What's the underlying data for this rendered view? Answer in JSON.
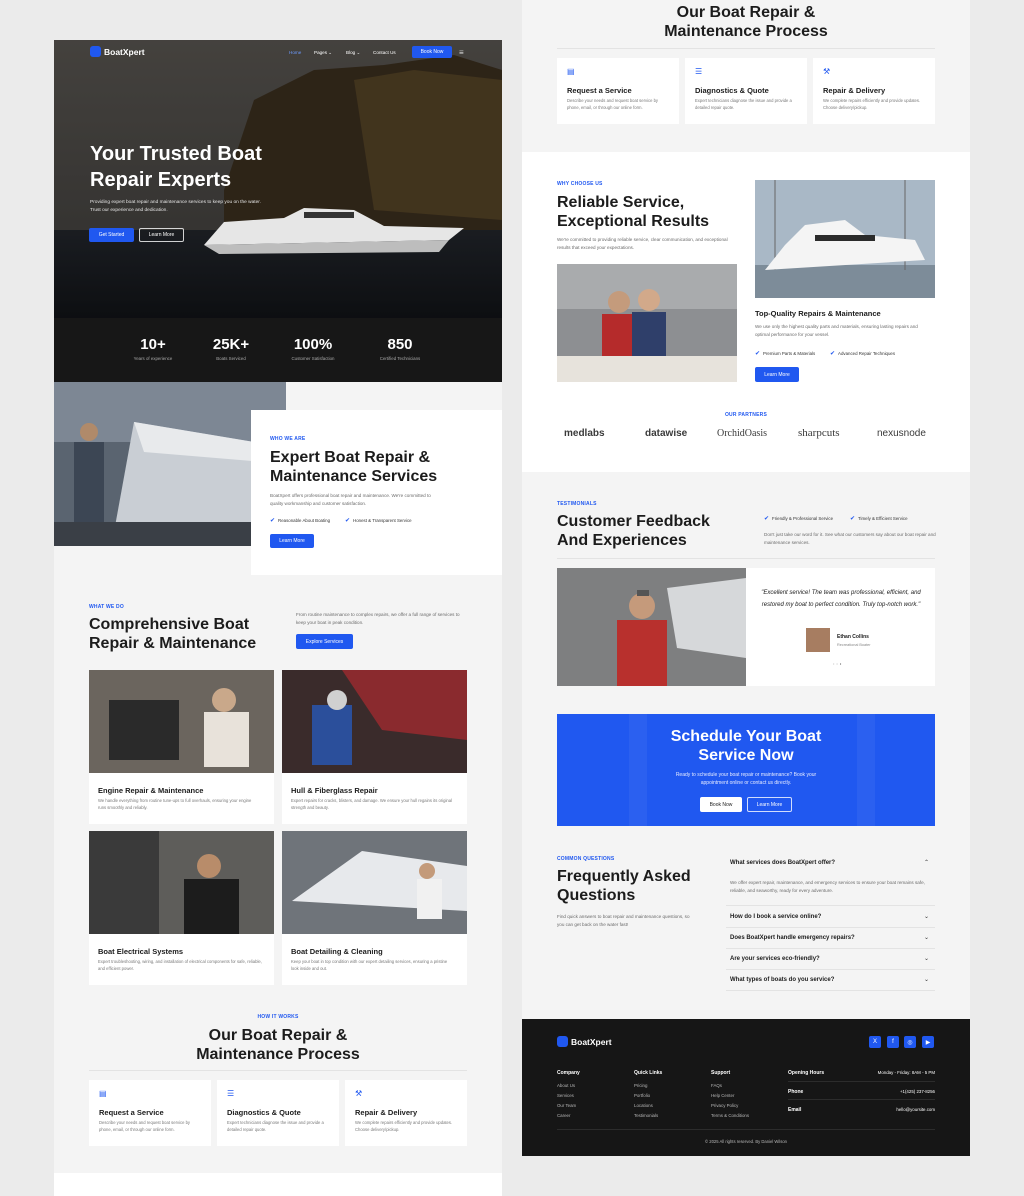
{
  "brand": {
    "name": "BoatXpert"
  },
  "nav": {
    "items": [
      "Home",
      "Pages ⌄",
      "Blog ⌄",
      "Contact Us"
    ],
    "cta": "Book Now"
  },
  "hero": {
    "title_line1": "Your Trusted Boat",
    "title_line2": "Repair Experts",
    "subtitle": "Providing expert boat repair and maintenance services to keep you on the water. Trust our experience and dedication.",
    "primary_btn": "Get Started",
    "secondary_btn": "Learn More"
  },
  "stats": [
    {
      "value": "10+",
      "label": "Years of experience"
    },
    {
      "value": "25K+",
      "label": "Boats Serviced"
    },
    {
      "value": "100%",
      "label": "Customer Satisfaction"
    },
    {
      "value": "850",
      "label": "Certified Technicians"
    }
  ],
  "about": {
    "eyebrow": "WHO WE ARE",
    "title_line1": "Expert Boat Repair &",
    "title_line2": "Maintenance Services",
    "text": "BoatXpert offers professional boat repair and maintenance. We're committed to quality workmanship and customer satisfaction.",
    "points": [
      "Reasonable About Boating",
      "Honest & Transparent Service"
    ],
    "btn": "Learn More"
  },
  "services": {
    "eyebrow": "WHAT WE DO",
    "title_line1": "Comprehensive Boat",
    "title_line2": "Repair & Maintenance",
    "text": "From routine maintenance to complex repairs, we offer a full range of services to keep your boat in peak condition.",
    "btn": "Explore Services",
    "items": [
      {
        "title": "Engine Repair & Maintenance",
        "desc": "We handle everything from routine tune-ups to full overhauls, ensuring your engine runs smoothly and reliably."
      },
      {
        "title": "Hull & Fiberglass Repair",
        "desc": "Expert repairs for cracks, blisters, and damage. We ensure your hull regains its original strength and beauty."
      },
      {
        "title": "Boat Electrical Systems",
        "desc": "Expert troubleshooting, wiring, and installation of electrical components for safe, reliable, and efficient power."
      },
      {
        "title": "Boat Detailing & Cleaning",
        "desc": "Keep your boat in top condition with our expert detailing services, ensuring a pristine look inside and out."
      }
    ]
  },
  "process": {
    "eyebrow": "HOW IT WORKS",
    "title_line1": "Our Boat Repair &",
    "title_line2": "Maintenance Process",
    "steps": [
      {
        "icon": "clipboard-icon",
        "title": "Request a Service",
        "desc": "Describe your needs and request boat service by phone, email, or through our online form."
      },
      {
        "icon": "checklist-icon",
        "title": "Diagnostics & Quote",
        "desc": "Expert technicians diagnose the issue and provide a detailed repair quote."
      },
      {
        "icon": "wrench-icon",
        "title": "Repair & Delivery",
        "desc": "We complete repairs efficiently and provide updates. Choose delivery/pickup."
      }
    ]
  },
  "why": {
    "eyebrow": "WHY CHOOSE US",
    "title_line1": "Reliable Service,",
    "title_line2": "Exceptional Results",
    "text": "We're committed to providing reliable service, clear communication, and exceptional results that exceed your expectations.",
    "feature_title": "Top-Quality Repairs & Maintenance",
    "feature_text": "We use only the highest quality parts and materials, ensuring lasting repairs and optimal performance for your vessel.",
    "points": [
      "Premium Parts & Materials",
      "Advanced Repair Techniques"
    ],
    "btn": "Learn More"
  },
  "partners": {
    "eyebrow": "OUR PARTNERS",
    "logos": [
      "medlabs",
      "datawise",
      "OrchidOasis",
      "sharpcuts",
      "nexusnode"
    ]
  },
  "testimonials": {
    "eyebrow": "TESTIMONIALS",
    "title_line1": "Customer Feedback",
    "title_line2": "And Experiences",
    "points": [
      "Friendly & Professional Service",
      "Timely & Efficient Service"
    ],
    "text": "Don't just take our word for it. See what our customers say about our boat repair and maintenance services.",
    "quote": "\"Excellent service! The team was professional, efficient, and restored my boat to perfect condition. Truly top-notch work.\"",
    "author": "Ethan Collins",
    "author_role": "Recreational Boater"
  },
  "cta": {
    "title_line1": "Schedule Your Boat",
    "title_line2": "Service Now",
    "text": "Ready to schedule your boat repair or maintenance? Book your appointment online or contact us directly.",
    "primary_btn": "Book Now",
    "secondary_btn": "Learn More"
  },
  "faq": {
    "eyebrow": "COMMON QUESTIONS",
    "title_line1": "Frequently Asked",
    "title_line2": "Questions",
    "text": "Find quick answers to boat repair and maintenance questions, so you can get back on the water fast!",
    "items": [
      {
        "q": "What services does BoatXpert offer?",
        "a": "We offer expert repair, maintenance, and emergency services to ensure your boat remains safe, reliable, and seaworthy, ready for every adventure."
      },
      {
        "q": "How do I book a service online?"
      },
      {
        "q": "Does BoatXpert handle emergency repairs?"
      },
      {
        "q": "Are your services eco-friendly?"
      },
      {
        "q": "What types of boats do you service?"
      }
    ]
  },
  "footer": {
    "company": {
      "title": "Company",
      "links": [
        "About Us",
        "Services",
        "Our Team",
        "Career"
      ]
    },
    "quick": {
      "title": "Quick Links",
      "links": [
        "Pricing",
        "Portfolio",
        "Locations",
        "Testimonials"
      ]
    },
    "support": {
      "title": "Support",
      "links": [
        "FAQs",
        "Help Center",
        "Privacy Policy",
        "Terms & Conditions"
      ]
    },
    "hours": {
      "title": "Opening Hours",
      "value": "Monday - Friday: 8AM - 5 PM"
    },
    "phone": {
      "title": "Phone",
      "value": "+1(425) 237-8256"
    },
    "email": {
      "title": "Email",
      "value": "hello@yoursite.com"
    },
    "copyright": "© 2025 All rights reserved. By Daniel Wilson",
    "social": [
      "x-icon",
      "facebook-icon",
      "instagram-icon",
      "youtube-icon"
    ]
  },
  "colors": {
    "accent": "#2058f0",
    "dark": "#161616",
    "bg": "#f4f4f4"
  }
}
